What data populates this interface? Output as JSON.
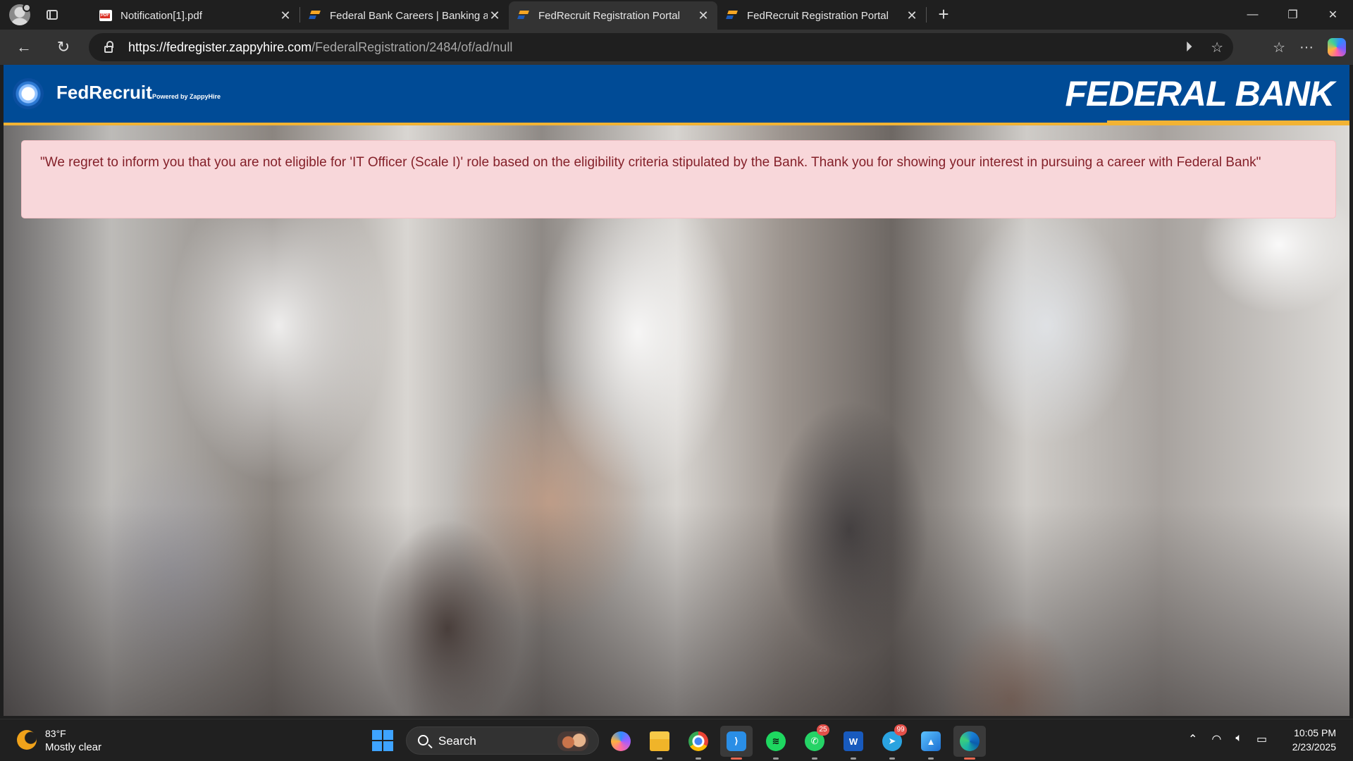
{
  "browser": {
    "tabs": [
      {
        "title": "Notification[1].pdf",
        "favicon": "pdf-icon",
        "active": false
      },
      {
        "title": "Federal Bank Careers | Banking ar",
        "favicon": "federal-bank-icon",
        "active": false
      },
      {
        "title": "FedRecruit Registration Portal",
        "favicon": "federal-bank-icon",
        "active": true
      },
      {
        "title": "FedRecruit Registration Portal",
        "favicon": "federal-bank-icon",
        "active": false
      }
    ],
    "url_domain": "https://fedregister.zappyhire.com",
    "url_path": "/FederalRegistration/2484/of/ad/null"
  },
  "page": {
    "brand": "FedRecruit",
    "powered_by": "Powered by ZappyHire",
    "bank_name": "FEDERAL BANK",
    "alert_message": "\"We regret to inform you that you are not eligible for 'IT Officer (Scale I)' role based on the eligibility criteria stipulated by the Bank. Thank you for showing your interest in pursuing a career with Federal Bank\"",
    "colors": {
      "header_blue": "#004b96",
      "accent_yellow": "#f2b334",
      "alert_bg": "#f8d7da",
      "alert_text": "#842029"
    }
  },
  "taskbar": {
    "weather_temp": "83°F",
    "weather_desc": "Mostly clear",
    "search_label": "Search",
    "apps": [
      {
        "name": "copilot-app-icon"
      },
      {
        "name": "file-explorer-icon"
      },
      {
        "name": "chrome-icon"
      },
      {
        "name": "vscode-icon"
      },
      {
        "name": "spotify-icon"
      },
      {
        "name": "whatsapp-icon",
        "badge": "25"
      },
      {
        "name": "word-icon"
      },
      {
        "name": "telegram-icon",
        "badge": "99"
      },
      {
        "name": "photos-icon"
      },
      {
        "name": "edge-icon"
      }
    ],
    "time": "10:05 PM",
    "date": "2/23/2025"
  }
}
